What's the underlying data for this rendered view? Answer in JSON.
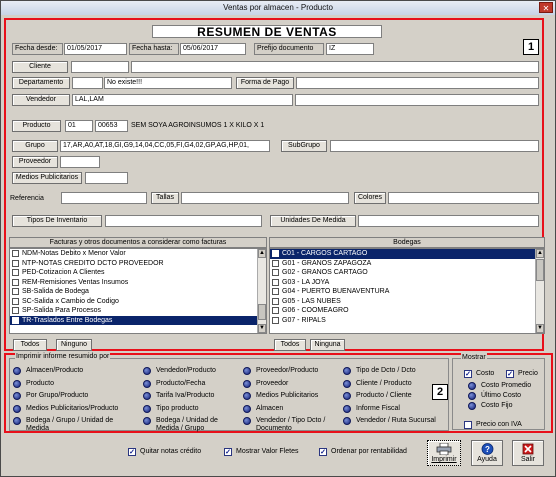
{
  "window": {
    "title": "Ventas por almacen - Producto",
    "close_glyph": "✕"
  },
  "badges": {
    "one": "1",
    "two": "2"
  },
  "report_title": "RESUMEN DE VENTAS",
  "filters": {
    "fecha_desde_label": "Fecha desde:",
    "fecha_desde_value": "01/05/2017",
    "fecha_hasta_label": "Fecha hasta:",
    "fecha_hasta_value": "05/06/2017",
    "prefijo_label": "Prefijo documento",
    "prefijo_value": "IZ",
    "cliente_label": "Cliente",
    "cliente_value": "",
    "departamento_label": "Departamento",
    "departamento_code": "",
    "departamento_value": "No existe!!!",
    "forma_pago_label": "Forma de Pago",
    "forma_pago_value": "",
    "vendedor_label": "Vendedor",
    "vendedor_value": "LAL,LAM",
    "producto_label": "Producto",
    "producto_code1": "01",
    "producto_code2": "00653",
    "producto_desc": "SEM SOYA AGROINSUMOS 1 X KILO X 1",
    "grupo_label": "Grupo",
    "grupo_value": "17,AR,A0,AT,18,GI,G9,14,04,CC,05,FI,G4,02,GP,AG,HP,01,",
    "subgrupo_label": "SubGrupo",
    "subgrupo_value": "",
    "proveedor_label": "Proveedor",
    "medios_label": "Medios Publicitarios",
    "referencia_label": "Referencia",
    "tallas_label": "Tallas",
    "colores_label": "Colores",
    "tipos_inventario_label": "Tipos De Inventario",
    "unidades_medida_label": "Unidades De Medida"
  },
  "docs_list": {
    "header": "Facturas y otros documentos a considerar como facturas",
    "items": [
      {
        "label": "NDM-Notas Debito x Menor Valor",
        "selected": false
      },
      {
        "label": "NTP-NOTAS CREDITO DCTO PROVEEDOR",
        "selected": false
      },
      {
        "label": "PED-Cotizacion A Clientes",
        "selected": false
      },
      {
        "label": "REM-Remisiones Ventas Insumos",
        "selected": false
      },
      {
        "label": "SB-Salida de Bodega",
        "selected": false
      },
      {
        "label": "SC-Salida x Cambio de Codigo",
        "selected": false
      },
      {
        "label": "SP-Salida Para Procesos",
        "selected": false
      },
      {
        "label": "TR-Traslados Entre Bodegas",
        "selected": true
      }
    ],
    "todos": "Todos",
    "ninguno": "Ninguno"
  },
  "bodegas_list": {
    "header": "Bodegas",
    "items": [
      {
        "label": "C01 - CARGOS CARTAGO",
        "selected": true
      },
      {
        "label": "G01 - GRANOS ZAPAGOZA",
        "selected": false
      },
      {
        "label": "G02 - GRANOS CARTAGO",
        "selected": false
      },
      {
        "label": "G03 - LA JOYA",
        "selected": false
      },
      {
        "label": "G04 - PUERTO BUENAVENTURA",
        "selected": false
      },
      {
        "label": "G05 - LAS NUBES",
        "selected": false
      },
      {
        "label": "G06 - COOMEAGRO",
        "selected": false
      },
      {
        "label": "G07 - RIPALS",
        "selected": false
      }
    ],
    "todos": "Todos",
    "ninguno": "Ninguna"
  },
  "summary": {
    "legend": "Imprimir informe resumido por",
    "col1": [
      "Almacen/Producto",
      "Producto",
      "Por Grupo/Producto",
      "Medios Publicitarios/Producto",
      "Bodega / Grupo / Unidad de Medida"
    ],
    "col2": [
      "Vendedor/Producto",
      "Producto/Fecha",
      "Tarifa Iva/Producto",
      "Tipo producto",
      "Bodega / Unidad de Medida / Grupo"
    ],
    "col3": [
      "Proveedor/Producto",
      "Proveedor",
      "Medios Publicitarios",
      "Almacen",
      "Vendedor / Tipo Dcto / Documento"
    ],
    "col4": [
      "Tipo de Dcto / Dcto",
      "Cliente / Producto",
      "Producto / Cliente",
      "Informe Fiscal",
      "Vendedor / Ruta Sucursal"
    ]
  },
  "mostrar": {
    "legend": "Mostrar",
    "costo": "Costo",
    "precio": "Precio",
    "opciones": [
      "Costo Promedio",
      "Último Costo",
      "Costo Fijo"
    ],
    "precio_iva": "Precio con IVA"
  },
  "bottom": {
    "quitar_notas": "Quitar notas crédito",
    "mostrar_fletes": "Mostrar Valor Fletes",
    "ordenar_rentabilidad": "Ordenar por rentabilidad",
    "imprimir": "Imprimir",
    "ayuda": "Ayuda",
    "salir": "Salir"
  }
}
